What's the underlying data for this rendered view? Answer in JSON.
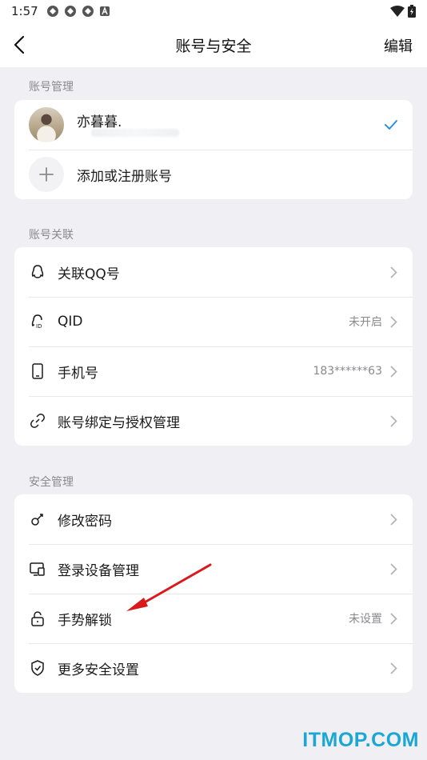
{
  "status_bar": {
    "time": "1:57",
    "icons": [
      "app-notification-icon",
      "app-notification-icon",
      "app-notification-icon",
      "a-notification-icon"
    ],
    "right_icons": [
      "wifi-icon",
      "battery-icon"
    ]
  },
  "nav": {
    "title": "账号与安全",
    "edit_label": "编辑"
  },
  "accounts": {
    "section_label": "账号管理",
    "current": {
      "name": "亦暮暮.",
      "selected": true
    },
    "add_label": "添加或注册账号"
  },
  "linking": {
    "section_label": "账号关联",
    "items": [
      {
        "icon": "qq-icon",
        "label": "关联QQ号",
        "value": ""
      },
      {
        "icon": "qid-icon",
        "label": "QID",
        "value": "未开启"
      },
      {
        "icon": "phone-icon",
        "label": "手机号",
        "value": "183******63"
      },
      {
        "icon": "link-icon",
        "label": "账号绑定与授权管理",
        "value": ""
      }
    ]
  },
  "security": {
    "section_label": "安全管理",
    "items": [
      {
        "icon": "key-icon",
        "label": "修改密码",
        "value": ""
      },
      {
        "icon": "device-icon",
        "label": "登录设备管理",
        "value": ""
      },
      {
        "icon": "lock-icon",
        "label": "手势解锁",
        "value": "未设置"
      },
      {
        "icon": "shield-icon",
        "label": "更多安全设置",
        "value": ""
      }
    ]
  },
  "colors": {
    "accent": "#1e88e5",
    "annotation_arrow": "#d9191c",
    "watermark": "#1aa7d4"
  },
  "watermark": "ITMOP.COM"
}
